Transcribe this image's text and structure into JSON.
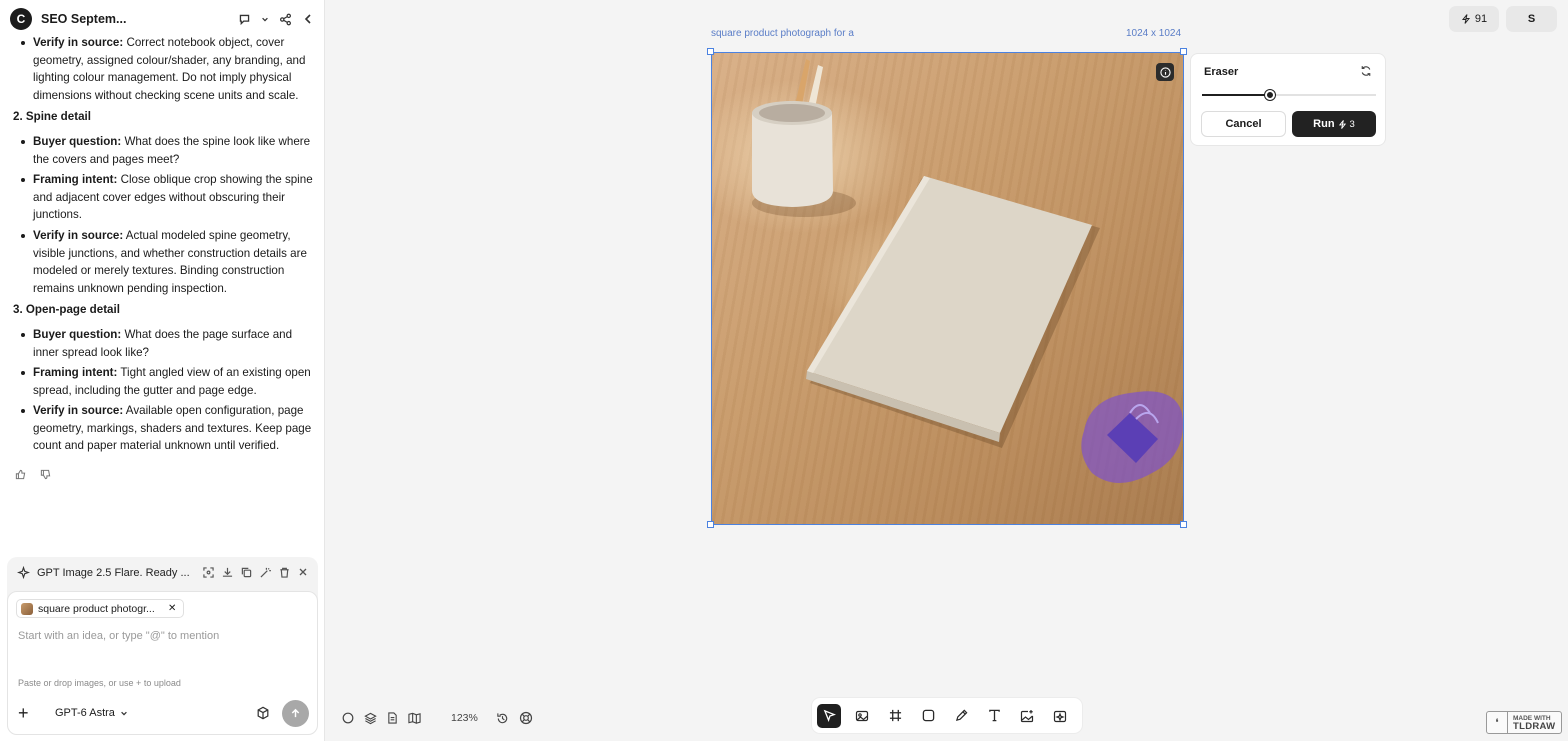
{
  "header": {
    "logo_letter": "C",
    "title": "SEO Septem..."
  },
  "doc": {
    "intro_item": {
      "label": "Verify in source:",
      "text": " Correct notebook object, cover geometry, assigned colour/shader, any branding, and lighting colour management. Do not imply physical dimensions without checking scene units and scale."
    },
    "sections": [
      {
        "heading": "2. Spine detail",
        "items": [
          {
            "label": "Buyer question:",
            "text": " What does the spine look like where the covers and pages meet?"
          },
          {
            "label": "Framing intent:",
            "text": " Close oblique crop showing the spine and adjacent cover edges without obscuring their junctions."
          },
          {
            "label": "Verify in source:",
            "text": " Actual modeled spine geometry, visible junctions, and whether construction details are modeled or merely textures. Binding construction remains unknown pending inspection."
          }
        ]
      },
      {
        "heading": "3. Open-page detail",
        "items": [
          {
            "label": "Buyer question:",
            "text": " What does the page surface and inner spread look like?"
          },
          {
            "label": "Framing intent:",
            "text": " Tight angled view of an existing open spread, including the gutter and page edge."
          },
          {
            "label": "Verify in source:",
            "text": " Available open configuration, page geometry, markings, shaders and textures. Keep page count and paper material unknown until verified."
          }
        ]
      }
    ]
  },
  "generation": {
    "status_text": "GPT Image 2.5 Flare. Ready ..."
  },
  "composer": {
    "chip_text": "square product photogr...",
    "placeholder": "Start with an idea, or type \"@\" to mention",
    "hint": "Paste or drop images, or use + to upload",
    "model": "GPT-6 Astra"
  },
  "canvas": {
    "image_title": "square product photograph for a",
    "image_size": "1024 x 1024",
    "zoom": "123%"
  },
  "eraser": {
    "title": "Eraser",
    "brush_size_fraction": 0.39,
    "cancel_label": "Cancel",
    "run_label": "Run",
    "run_cost": "3"
  },
  "topbar": {
    "credits": "91",
    "user_initial": "S"
  },
  "watermark": {
    "line1": "MADE WITH",
    "line2": "TLDRAW"
  },
  "colors": {
    "selection": "#4b82e0",
    "run_button": "#222222",
    "eraser_mask": "#7a4fd6"
  }
}
